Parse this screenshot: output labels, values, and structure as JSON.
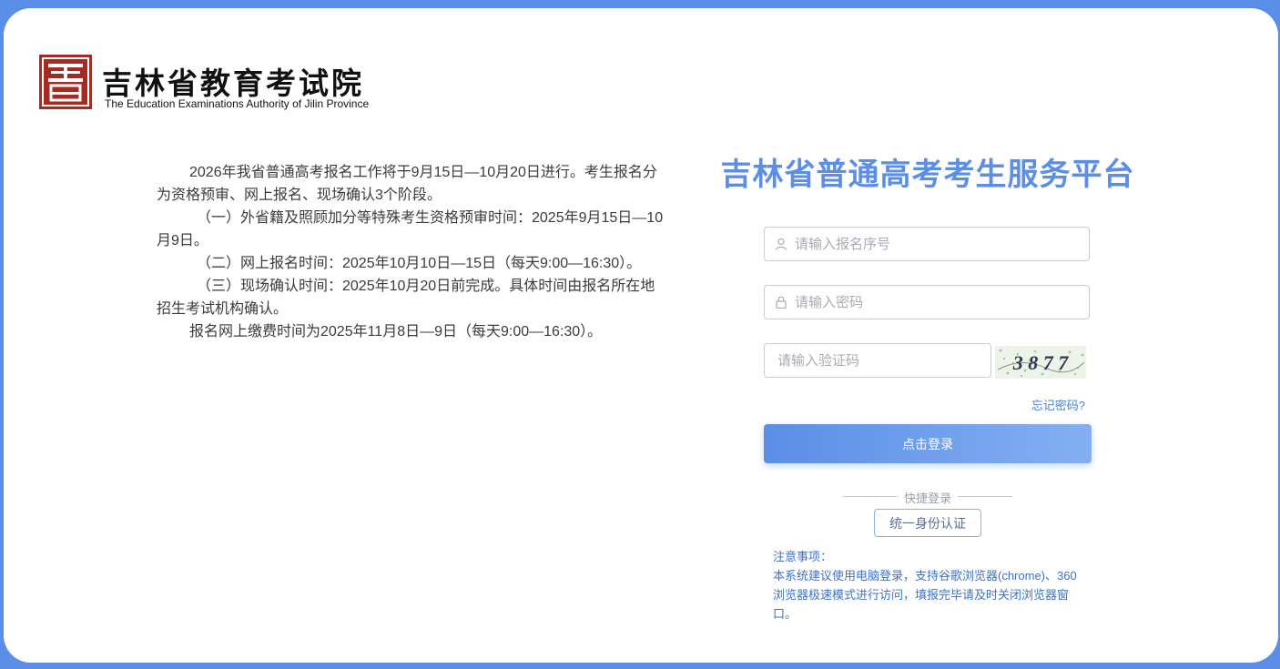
{
  "logo": {
    "title": "吉林省教育考试院",
    "subtitle": "The Education Examinations Authority of Jilin Province"
  },
  "notice": {
    "paragraphs": [
      "2026年我省普通高考报名工作将于9月15日—10月20日进行。考生报名分为资格预审、网上报名、现场确认3个阶段。",
      "（一）外省籍及照顾加分等特殊考生资格预审时间：2025年9月15日—10月9日。",
      "（二）网上报名时间：2025年10月10日—15日（每天9:00—16:30）。",
      "（三）现场确认时间：2025年10月20日前完成。具体时间由报名所在地招生考试机构确认。",
      "报名网上缴费时间为2025年11月8日—9日（每天9:00—16:30）。"
    ]
  },
  "login": {
    "title": "吉林省普通高考考生服务平台",
    "username_placeholder": "请输入报名序号",
    "password_placeholder": "请输入密码",
    "captcha_placeholder": "请输入验证码",
    "captcha_text": "3 8 7 7",
    "forgot": "忘记密码?",
    "submit": "点击登录",
    "quick_login": "快捷登录",
    "sso": "统一身份认证"
  },
  "tips": {
    "heading": "注意事项：",
    "body": "本系统建议使用电脑登录，支持谷歌浏览器(chrome)、360浏览器极速模式进行访问，填报完毕请及时关闭浏览器窗口。"
  },
  "colors": {
    "frame": "#5b8ee6",
    "accent": "#5b8ee6",
    "logo_red": "#a42a22",
    "tips": "#3d72c8"
  },
  "icons": {
    "username": "user-icon",
    "password": "lock-icon"
  }
}
